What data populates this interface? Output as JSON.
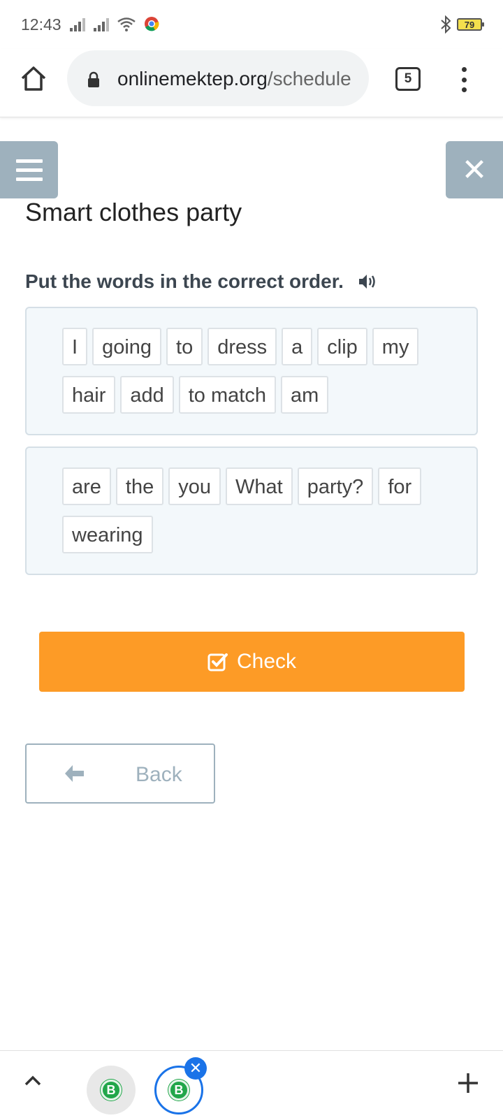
{
  "status_bar": {
    "time": "12:43",
    "battery": "79"
  },
  "browser": {
    "url_domain": "onlinemektep.org",
    "url_path": "/schedule",
    "tab_count": "5"
  },
  "page": {
    "title": "Smart clothes party",
    "instruction": "Put the words in the correct order.",
    "sentence_1_words": [
      "I",
      "going",
      "to",
      "dress",
      "a",
      "clip",
      "my",
      "hair",
      "add",
      "to match",
      "am"
    ],
    "sentence_2_words": [
      "are",
      "the",
      "you",
      "What",
      "party?",
      "for",
      "wearing"
    ],
    "check_label": "Check",
    "back_label": "Back"
  },
  "colors": {
    "accent": "#fd9b26",
    "nav_button": "#9eb1bd",
    "box_background": "#f3f8fb",
    "tab_active_ring": "#1a73e8",
    "tab_logo": "#21a64a"
  },
  "icons": [
    "home-icon",
    "lock-icon",
    "more-vert-icon",
    "hamburger-icon",
    "close-icon",
    "speaker-icon",
    "check-square-icon",
    "arrow-left-icon",
    "chevron-up-icon",
    "plus-icon"
  ]
}
